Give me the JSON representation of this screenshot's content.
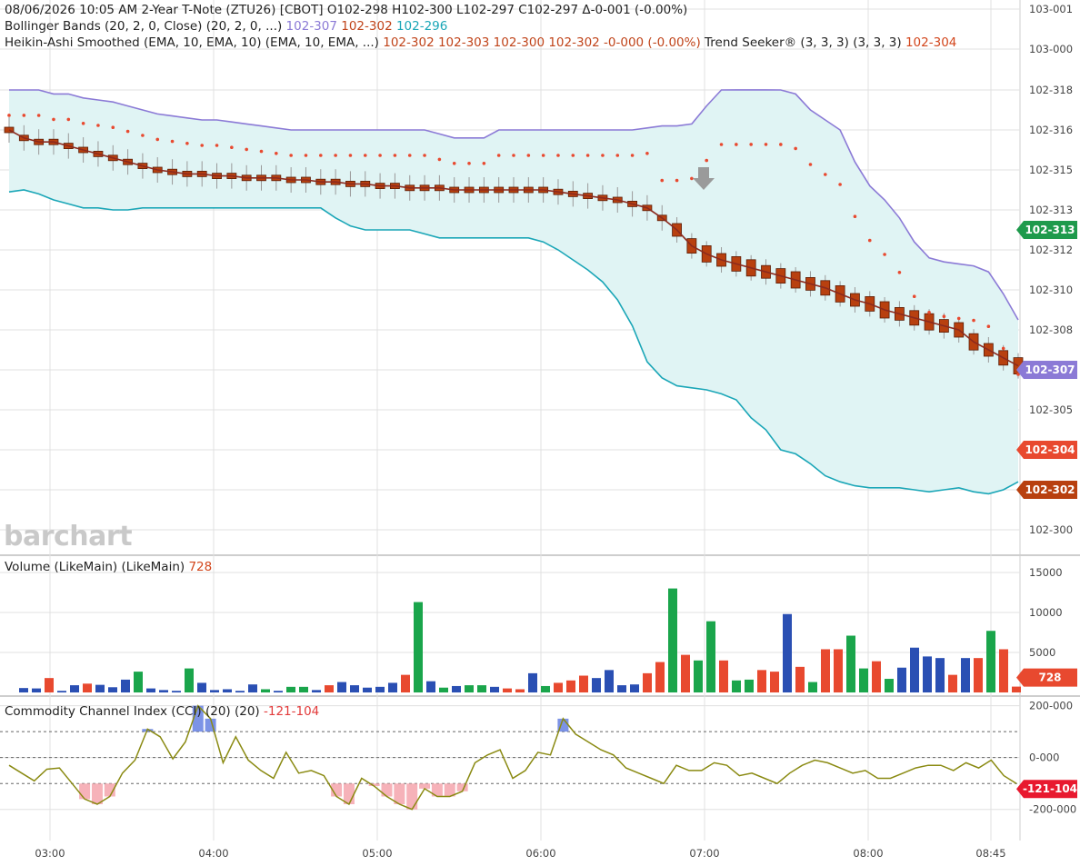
{
  "header": {
    "line1": "08/06/2026  10:05 AM  2-Year T-Note (ZTU26) [CBOT]  O102-298  H102-300  L102-297  C102-297  Δ-0-001 (-0.00%)",
    "bb_label": "Bollinger Bands (20, 2, 0, Close)  (20, 2, 0, ...)",
    "bb_upper": "102-307",
    "bb_mid": "102-302",
    "bb_lower": "102-296",
    "ha_label": "Heikin-Ashi Smoothed (EMA, 10, EMA, 10)  (EMA, 10, EMA, ...)",
    "ha_values": "102-302  102-303  102-300  102-302  -0-000 (-0.00%)",
    "ts_label": "Trend Seeker® (3, 3, 3)  (3, 3, 3)",
    "ts_value": "102-304"
  },
  "volume_label": "Volume (LikeMain)  (LikeMain)",
  "volume_value": "728",
  "cci_label": "Commodity Channel Index (CCI) (20)  (20)",
  "cci_value": "-121-104",
  "watermark": "barchart",
  "colors": {
    "bb_upper": "#8b7ad6",
    "bb_mid": "#8b2a1e",
    "bb_lower": "#1aa6b7",
    "ha_candle": "#b8400f",
    "vol_up": "#1aa54b",
    "vol_down": "#e8492f",
    "vol_neutral": "#2a4fb3",
    "cci_line": "#8a8a12",
    "cci_high_fill": "#5b78e0",
    "cci_low_fill": "#f4a5ad",
    "trend_dot": "#e8492f",
    "grid": "#e0e0e0"
  },
  "price_tags": [
    {
      "label": "102-313",
      "price": 102.3125,
      "color": "#1e9a4c"
    },
    {
      "label": "102-307",
      "price": 102.307,
      "color": "#8b7ad6"
    },
    {
      "label": "102-304",
      "price": 102.304,
      "color": "#e8492f"
    },
    {
      "label": "102-302",
      "price": 102.302,
      "color": "#b8400f"
    },
    {
      "label": "-121-104",
      "cci": -121,
      "color": "#e8192f"
    },
    {
      "label": "728",
      "vol": 728,
      "color": "#e8492f"
    }
  ],
  "chart_data": [
    {
      "type": "line",
      "title": "2-Year T-Note (ZTU26) [CBOT]",
      "panel": "price",
      "x_ticks": [
        "03:00",
        "04:00",
        "05:00",
        "06:00",
        "07:00",
        "08:00",
        "08:45"
      ],
      "y_ticks": [
        "103-001",
        "103-000",
        "102-318",
        "102-316",
        "102-315",
        "102-313",
        "102-312",
        "102-310",
        "102-308",
        "102-307",
        "102-305",
        "102-304",
        "102-302",
        "102-300"
      ],
      "y_tick_values": [
        103.0015,
        103.0,
        102.318,
        102.316,
        102.315,
        102.313,
        102.312,
        102.31,
        102.308,
        102.307,
        102.305,
        102.304,
        102.302,
        102.3
      ],
      "ylim": [
        102.2993,
        103.002
      ],
      "series": [
        {
          "name": "Bollinger Upper",
          "values": [
            102.3185,
            102.3183,
            102.318,
            102.3178,
            102.3178,
            102.3176,
            102.3175,
            102.3174,
            102.3172,
            102.317,
            102.3168,
            102.3167,
            102.3166,
            102.3165,
            102.3165,
            102.3164,
            102.3163,
            102.3162,
            102.3161,
            102.316,
            102.316,
            102.316,
            102.316,
            102.316,
            102.316,
            102.316,
            102.316,
            102.316,
            102.316,
            102.3159,
            102.3158,
            102.3158,
            102.3158,
            102.316,
            102.316,
            102.316,
            102.316,
            102.316,
            102.316,
            102.316,
            102.316,
            102.316,
            102.316,
            102.3161,
            102.3162,
            102.3162,
            102.3163,
            102.3172,
            102.318,
            102.3189,
            102.3191,
            102.319,
            102.3186,
            102.3178,
            102.317,
            102.3165,
            102.316,
            102.3152,
            102.3142,
            102.3135,
            102.3128,
            102.3122,
            102.3116,
            102.3114,
            102.3113,
            102.3112,
            102.3109,
            102.3098,
            102.3085
          ]
        },
        {
          "name": "Bollinger Lower",
          "values": [
            102.3139,
            102.314,
            102.3138,
            102.3135,
            102.3133,
            102.3131,
            102.3131,
            102.313,
            102.313,
            102.3131,
            102.3131,
            102.3131,
            102.3131,
            102.3131,
            102.3131,
            102.3131,
            102.3131,
            102.3131,
            102.3131,
            102.3131,
            102.3131,
            102.3131,
            102.3128,
            102.3126,
            102.3125,
            102.3125,
            102.3125,
            102.3125,
            102.3124,
            102.3123,
            102.3123,
            102.3123,
            102.3123,
            102.3123,
            102.3123,
            102.3123,
            102.3122,
            102.312,
            102.3115,
            102.311,
            102.3104,
            102.3095,
            102.3082,
            102.3072,
            102.3066,
            102.3062,
            102.3061,
            102.306,
            102.3058,
            102.3055,
            102.3048,
            102.3045,
            102.304,
            102.3038,
            102.3033,
            102.3027,
            102.3024,
            102.3022,
            102.3021,
            102.3021,
            102.3021,
            102.302,
            102.3019,
            102.302,
            102.3021,
            102.3019,
            102.3018,
            102.302,
            102.3024
          ]
        },
        {
          "name": "Heikin-Ashi Mid (EMA)",
          "values": [
            102.316,
            102.3158,
            102.3157,
            102.3157,
            102.3156,
            102.3155,
            102.3154,
            102.3153,
            102.3152,
            102.3151,
            102.315,
            102.3149,
            102.3148,
            102.3148,
            102.3147,
            102.3147,
            102.3146,
            102.3146,
            102.3146,
            102.3145,
            102.3145,
            102.3144,
            102.3144,
            102.3143,
            102.3143,
            102.3142,
            102.3142,
            102.3141,
            102.3141,
            102.3141,
            102.314,
            102.314,
            102.314,
            102.314,
            102.314,
            102.314,
            102.314,
            102.3139,
            102.3138,
            102.3137,
            102.3136,
            102.3135,
            102.3133,
            102.3131,
            102.3128,
            102.3125,
            102.3121,
            102.3118,
            102.3115,
            102.3113,
            102.3111,
            102.3109,
            102.3107,
            102.3105,
            102.3103,
            102.3101,
            102.3098,
            102.3095,
            102.3093,
            102.309,
            102.3088,
            102.3086,
            102.3084,
            102.3082,
            102.308,
            102.3077,
            102.3075,
            102.3073,
            102.3071
          ]
        }
      ]
    },
    {
      "type": "bar",
      "title": "Volume (LikeMain)",
      "panel": "volume",
      "y_ticks": [
        "15000",
        "10000",
        "5000"
      ],
      "ylim": [
        0,
        15000
      ],
      "values": [
        550,
        500,
        1800,
        200,
        900,
        1100,
        950,
        650,
        1600,
        2600,
        500,
        300,
        200,
        3000,
        1200,
        300,
        400,
        200,
        1000,
        400,
        200,
        700,
        700,
        300,
        900,
        1300,
        900,
        600,
        700,
        1200,
        2200,
        11300,
        1400,
        600,
        800,
        900,
        900,
        700,
        500,
        400,
        2400,
        800,
        1200,
        1500,
        2100,
        1800,
        2800,
        900,
        1000,
        2400,
        3800,
        13000,
        4700,
        4000,
        8900,
        4000,
        1500,
        1600,
        2800,
        2600,
        9800,
        3200,
        1300,
        5400,
        5400,
        7100,
        3000,
        3900,
        1700,
        3100,
        5600,
        4500,
        4300,
        2200,
        4300,
        4300,
        7700,
        5400,
        728
      ],
      "colors": [
        "n",
        "n",
        "d",
        "n",
        "n",
        "d",
        "n",
        "n",
        "n",
        "u",
        "n",
        "n",
        "n",
        "u",
        "n",
        "n",
        "n",
        "n",
        "n",
        "u",
        "n",
        "u",
        "u",
        "n",
        "d",
        "n",
        "n",
        "n",
        "n",
        "n",
        "d",
        "u",
        "n",
        "u",
        "n",
        "u",
        "u",
        "n",
        "d",
        "d",
        "n",
        "u",
        "d",
        "d",
        "d",
        "n",
        "n",
        "n",
        "n",
        "d",
        "d",
        "u",
        "d",
        "u",
        "u",
        "d",
        "u",
        "u",
        "d",
        "d",
        "n",
        "d",
        "u",
        "d",
        "d",
        "u",
        "u",
        "d",
        "u",
        "n",
        "n",
        "n",
        "n",
        "d",
        "n",
        "d",
        "u",
        "d",
        "d"
      ]
    },
    {
      "type": "line",
      "title": "Commodity Channel Index (CCI) (20)",
      "panel": "cci",
      "y_ticks": [
        "200-000",
        "0-000",
        "-200-000"
      ],
      "ylim": [
        -320,
        230
      ],
      "values": [
        -30,
        -60,
        -90,
        -45,
        -40,
        -100,
        -160,
        -180,
        -150,
        -60,
        -10,
        110,
        80,
        -5,
        60,
        200,
        150,
        -20,
        80,
        -10,
        -50,
        -80,
        20,
        -60,
        -50,
        -70,
        -150,
        -180,
        -80,
        -110,
        -150,
        -180,
        -200,
        -120,
        -150,
        -150,
        -130,
        -20,
        10,
        30,
        -80,
        -50,
        20,
        10,
        150,
        90,
        60,
        30,
        10,
        -40,
        -60,
        -80,
        -100,
        -30,
        -50,
        -50,
        -20,
        -30,
        -70,
        -60,
        -80,
        -100,
        -60,
        -30,
        -10,
        -20,
        -40,
        -60,
        -50,
        -80,
        -80,
        -60,
        -40,
        -30,
        -30,
        -50,
        -20,
        -40,
        -10,
        -70,
        -100
      ],
      "ref_lines": [
        100,
        0,
        -100
      ]
    }
  ]
}
